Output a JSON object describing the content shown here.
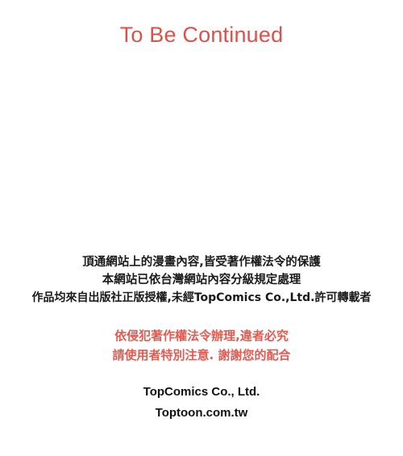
{
  "title": "To Be Continued",
  "notice": {
    "line1": "頂通網站上的漫畫內容,皆受著作權法令的保護",
    "line2": "本網站已依台灣網站內容分級規定處理",
    "line3": "作品均來自出版社正版授權,未經TopComics Co.,Ltd.許可轉載者"
  },
  "warning": {
    "line1": "依侵犯著作權法令辦理,違者必究",
    "line2": "請使用者特別注意. 謝謝您的配合"
  },
  "company": {
    "name": "TopComics Co., Ltd.",
    "website": "Toptoon.com.tw"
  },
  "colors": {
    "accent": "#d9534a",
    "warning": "#e35a50",
    "text": "#1a1a1a"
  }
}
